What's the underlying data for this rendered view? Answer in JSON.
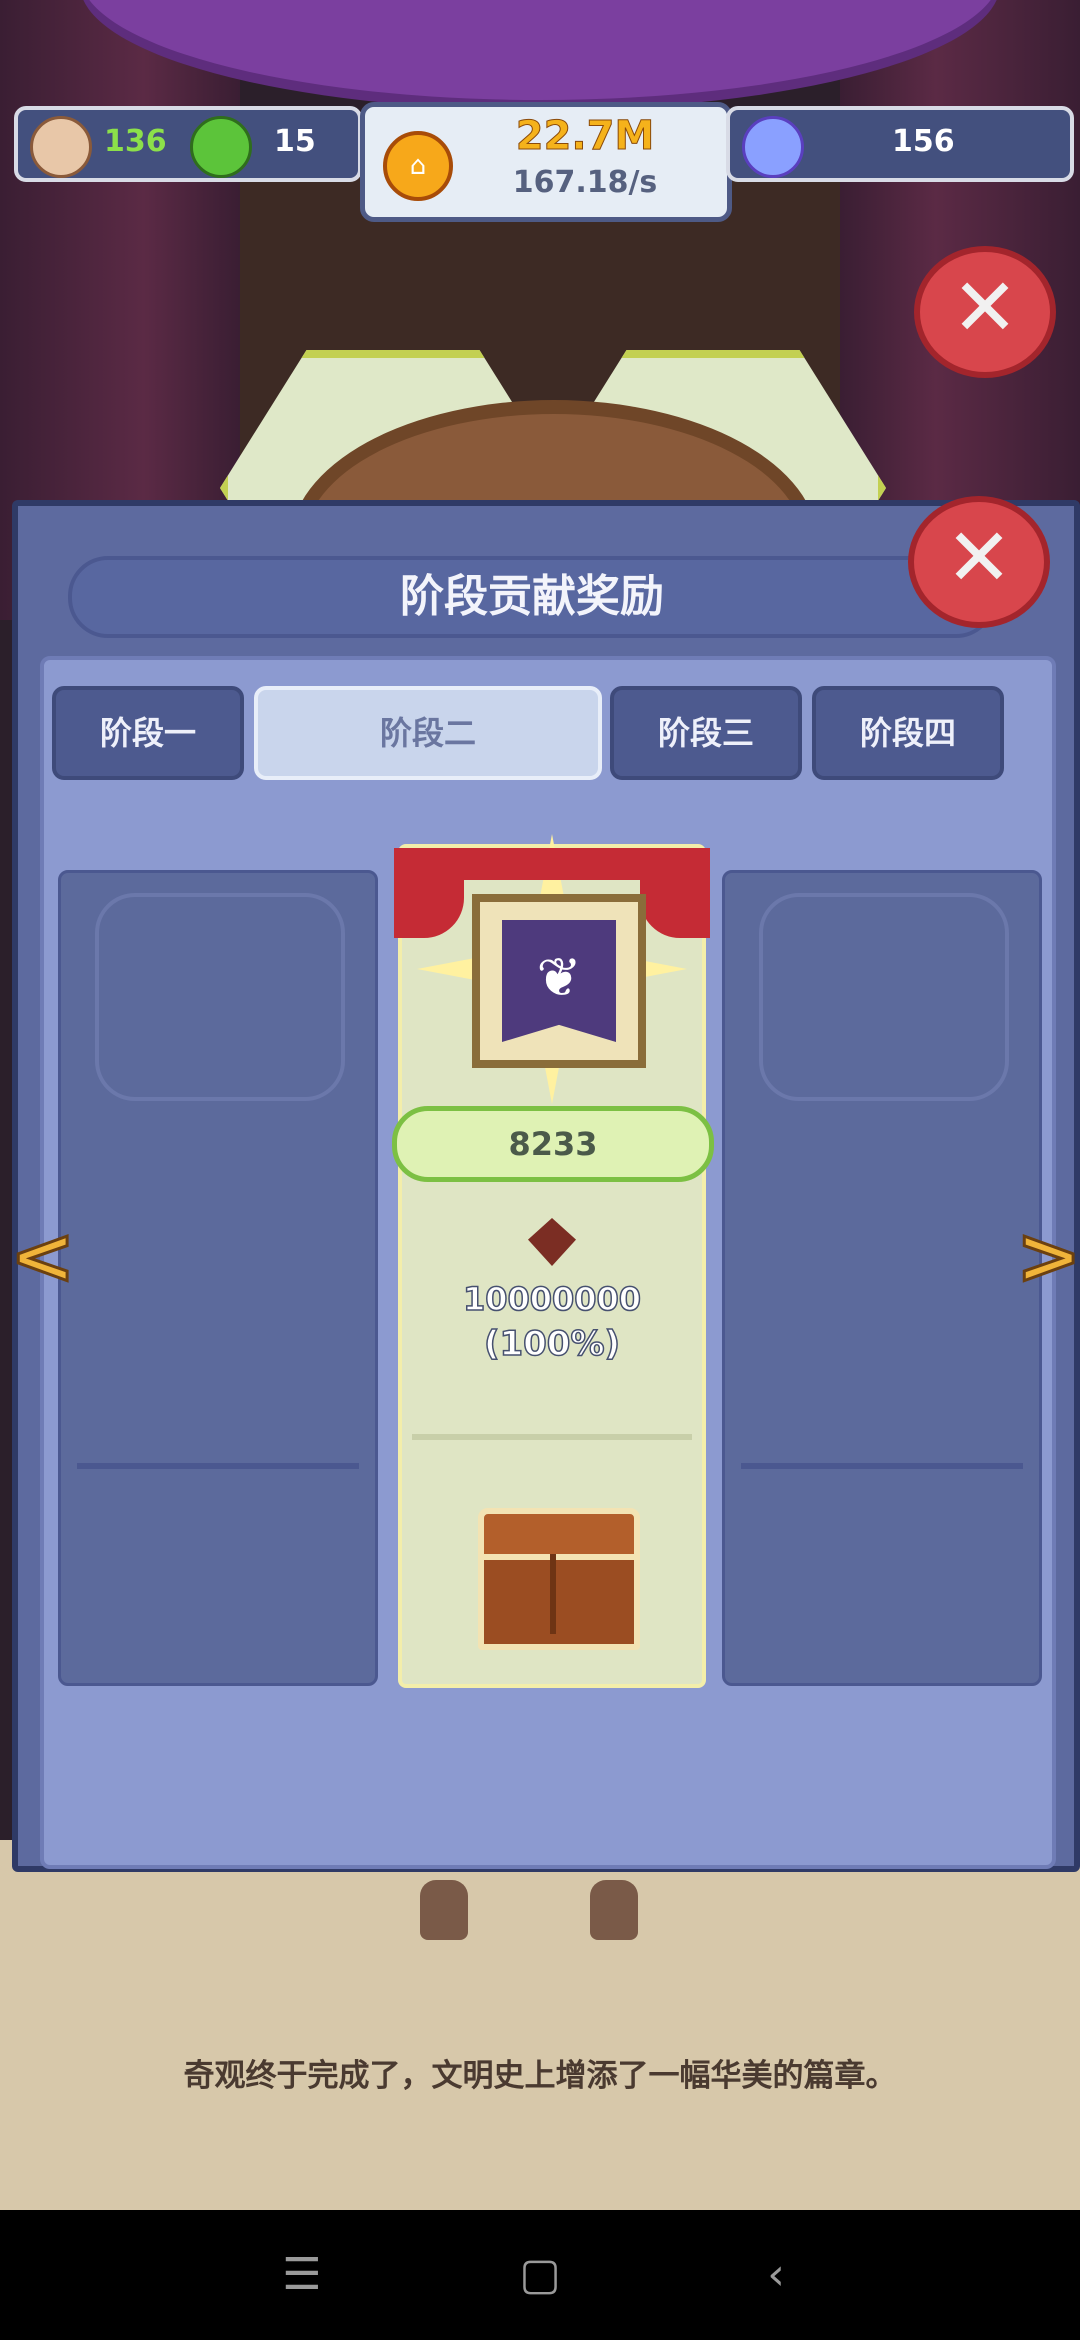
{
  "resources": {
    "population": "136",
    "happiness": "15",
    "gold_amount": "22.7M",
    "gold_rate": "167.18/s",
    "gems": "156"
  },
  "panel": {
    "title": "阶段贡献奖励",
    "tabs": [
      {
        "label": "阶段一",
        "active": false
      },
      {
        "label": "阶段二",
        "active": true
      },
      {
        "label": "阶段三",
        "active": false
      },
      {
        "label": "阶段四",
        "active": false
      }
    ],
    "reward_card": {
      "score": "8233",
      "requirement": "10000000",
      "progress": "(100%)"
    }
  },
  "story": {
    "text": "奇观终于完成了，文明史上增添了一幅华美的篇章。"
  },
  "icons": {
    "close": "✕",
    "prev": "<",
    "next": ">",
    "nav_menu": "☰",
    "nav_home": "▢",
    "nav_back": "‹"
  },
  "colors": {
    "panel": "#5d6a9f",
    "close_button": "#d8464c",
    "score_pill": "#7cc043",
    "gold": "#f5b21b"
  }
}
